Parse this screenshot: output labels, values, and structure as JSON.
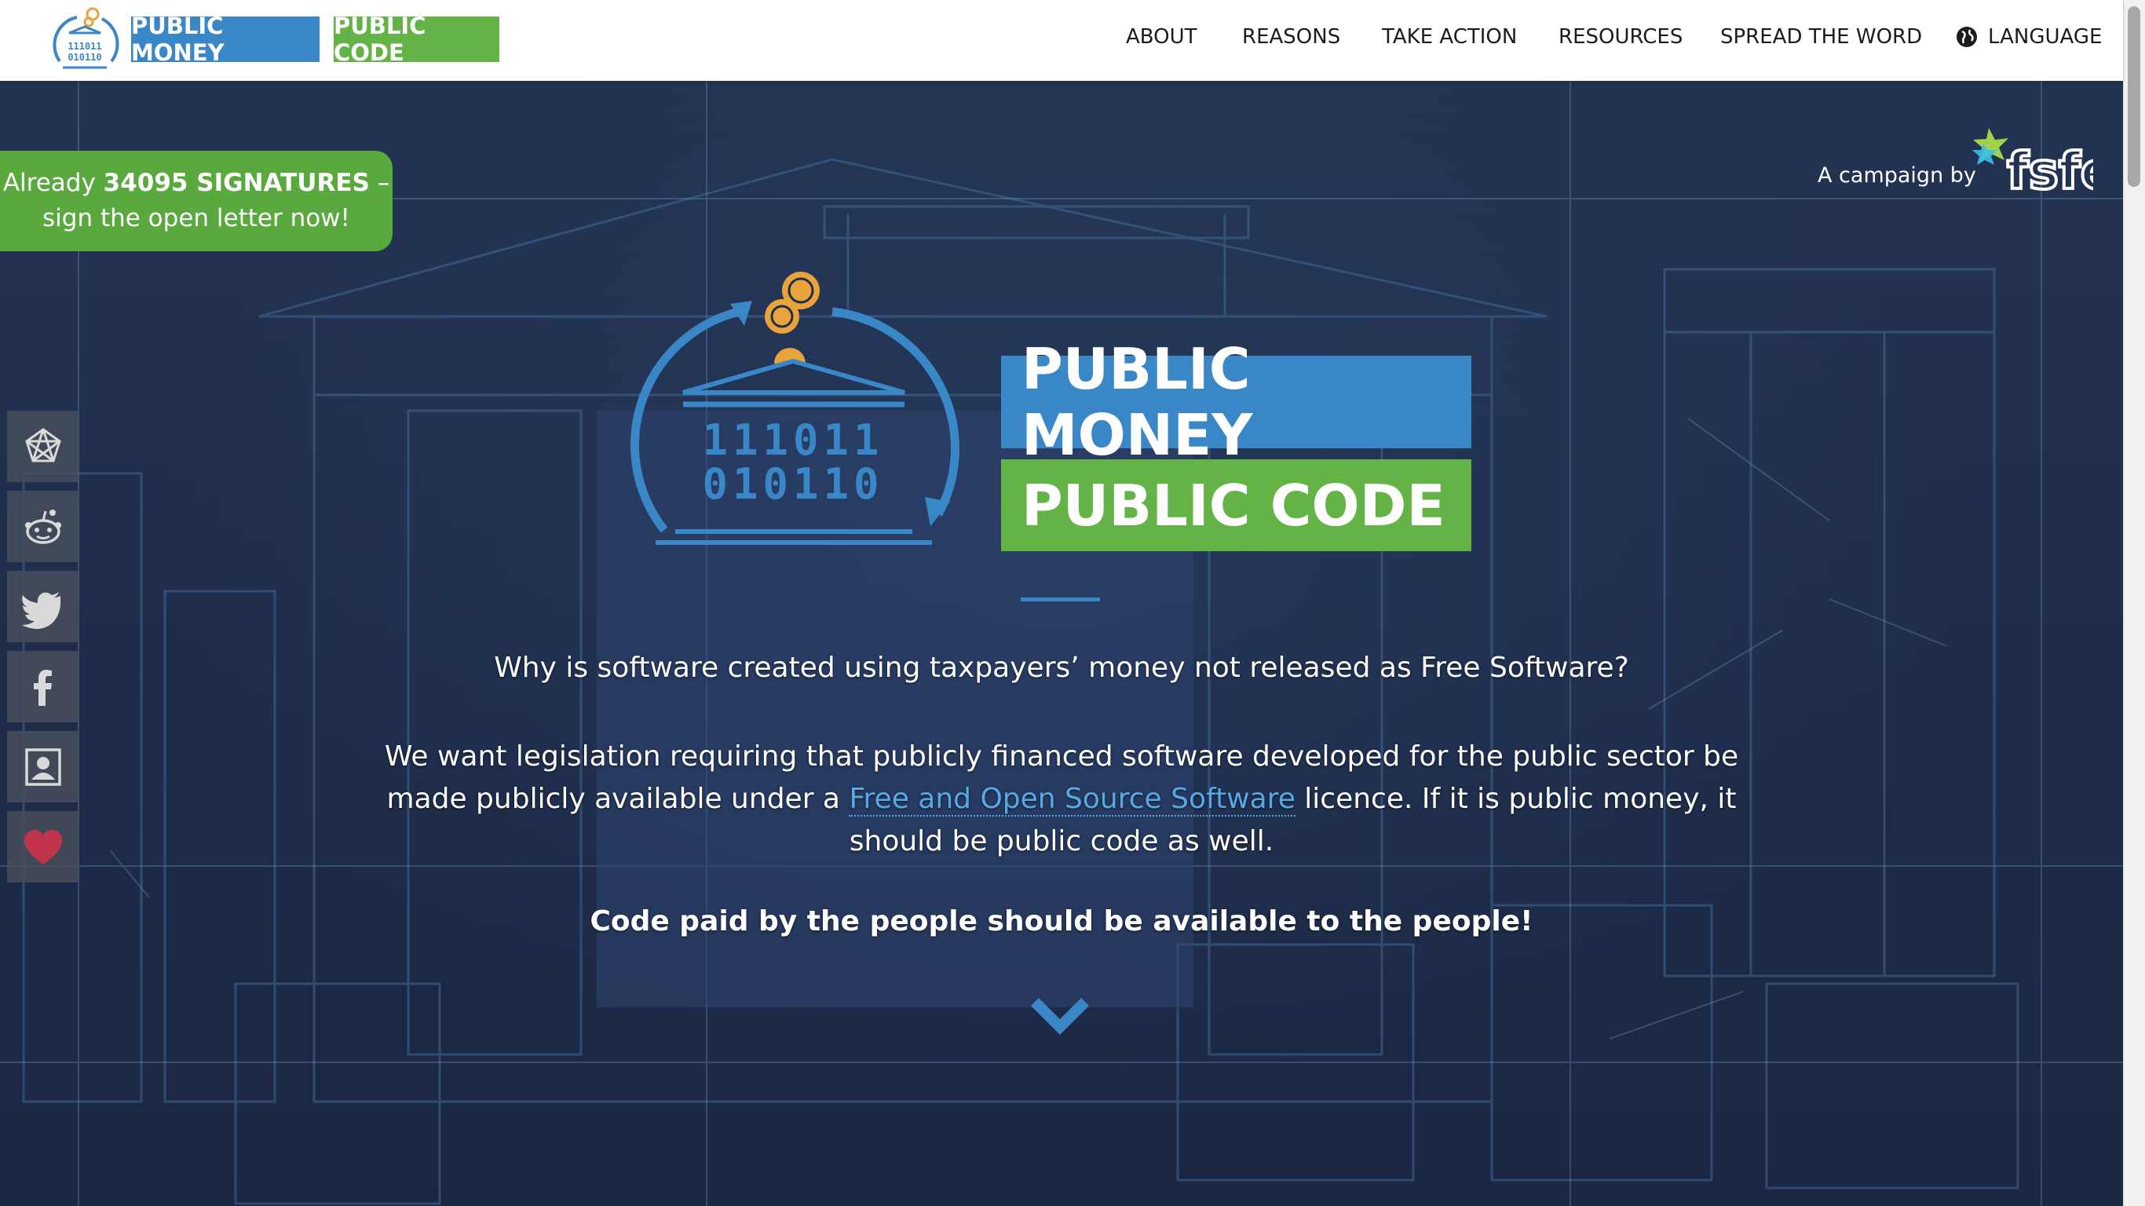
{
  "header": {
    "brand_money": "PUBLIC MONEY",
    "brand_code": "PUBLIC CODE",
    "logo_binary_top": "111011",
    "logo_binary_bottom": "010110",
    "nav": [
      "ABOUT",
      "REASONS",
      "TAKE ACTION",
      "RESOURCES",
      "SPREAD THE WORD",
      "LANGUAGE"
    ]
  },
  "banner": {
    "prefix": "Already",
    "count": "34095 SIGNATURES",
    "suffix": "–",
    "line2": "sign the open letter now!"
  },
  "campaign": {
    "label": "A campaign by",
    "org": "fsfe"
  },
  "share": [
    "fediverse-icon",
    "reddit-icon",
    "twitter-icon",
    "facebook-icon",
    "contact-icon",
    "heart-icon"
  ],
  "hero": {
    "title_money": "PUBLIC MONEY",
    "title_code": "PUBLIC CODE",
    "binary_top": "111011",
    "binary_bottom": "010110",
    "question": "Why is software created using taxpayers’ money not released as Free Software?",
    "para_line1": "We want legislation requiring that publicly financed software developed for the public sector be",
    "para_line2_pre": "made publicly available under a",
    "para_link": "Free and Open Source Software",
    "para_line2_post": "licence. If it is public money, it",
    "para_line3": "should be public code as well.",
    "slogan": "Code paid by the people should be available to the people!"
  },
  "colors": {
    "blue": "#3a87c8",
    "green": "#64b346",
    "link": "#57a9e6"
  }
}
